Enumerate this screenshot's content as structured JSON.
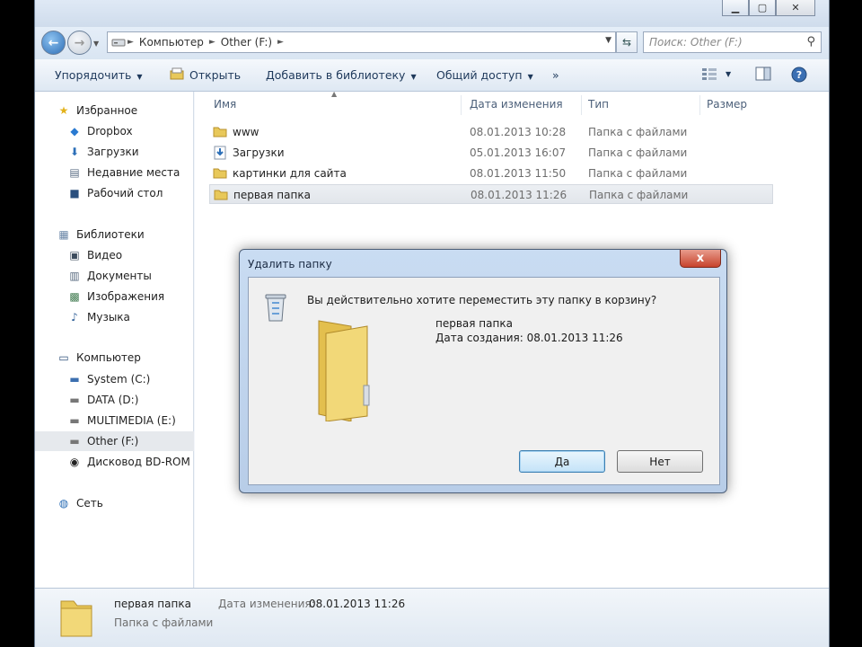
{
  "address": {
    "crumbs": [
      "Компьютер",
      "Other (F:)"
    ],
    "search_placeholder": "Поиск: Other (F:)"
  },
  "toolbar": {
    "organize": "Упорядочить",
    "open": "Открыть",
    "add_to_library": "Добавить в библиотеку",
    "share": "Общий доступ",
    "more": "»"
  },
  "nav": {
    "favorites": {
      "title": "Избранное",
      "items": [
        "Dropbox",
        "Загрузки",
        "Недавние места",
        "Рабочий стол"
      ]
    },
    "libraries": {
      "title": "Библиотеки",
      "items": [
        "Видео",
        "Документы",
        "Изображения",
        "Музыка"
      ]
    },
    "computer": {
      "title": "Компьютер",
      "items": [
        "System (C:)",
        "DATA (D:)",
        "MULTIMEDIA (E:)",
        "Other (F:)",
        "Дисковод BD-ROM"
      ]
    },
    "network": "Сеть"
  },
  "columns": {
    "name": "Имя",
    "modified": "Дата изменения",
    "type": "Тип",
    "size": "Размер"
  },
  "files": [
    {
      "name": "www",
      "modified": "08.01.2013 10:28",
      "type": "Папка с файлами"
    },
    {
      "name": "Загрузки",
      "modified": "05.01.2013 16:07",
      "type": "Папка с файлами"
    },
    {
      "name": "картинки для сайта",
      "modified": "08.01.2013 11:50",
      "type": "Папка с файлами"
    },
    {
      "name": "первая папка",
      "modified": "08.01.2013 11:26",
      "type": "Папка с файлами"
    }
  ],
  "details": {
    "name": "первая папка",
    "modified_label": "Дата изменения:",
    "modified_value": "08.01.2013 11:26",
    "type": "Папка с файлами"
  },
  "dialog": {
    "title": "Удалить папку",
    "close": "x",
    "question": "Вы действительно хотите переместить эту папку в корзину?",
    "item_name": "первая папка",
    "item_created": "Дата создания: 08.01.2013 11:26",
    "yes": "Да",
    "no": "Нет"
  },
  "colors": {
    "folder": "#e8c85a",
    "accent": "#1e395b",
    "dialog_frame": "#b8cde8"
  }
}
